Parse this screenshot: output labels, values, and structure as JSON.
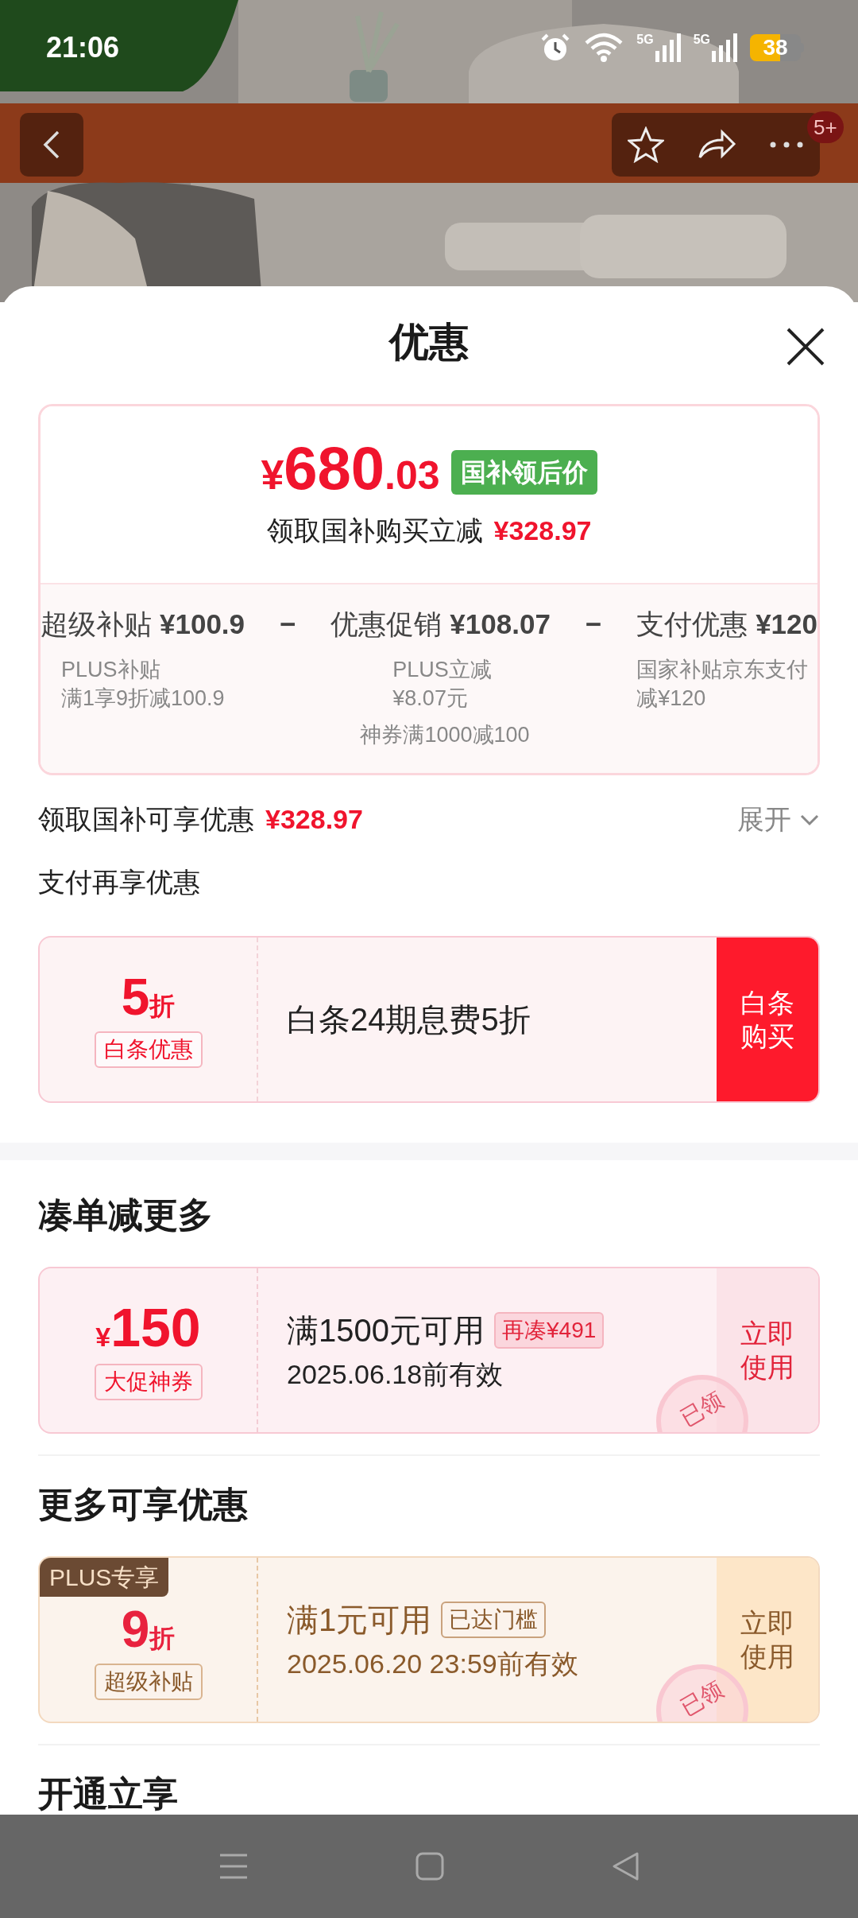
{
  "status_bar": {
    "time": "21:06",
    "network_1": "5G",
    "network_2": "5G",
    "battery": "38"
  },
  "header": {
    "badge": "5+"
  },
  "sheet": {
    "title": "优惠"
  },
  "price_card": {
    "currency": "¥",
    "integer": "680",
    "decimal": ".03",
    "tag": "国补领后价",
    "saving_label": "领取国补购买立减",
    "saving_amount": "¥328.97",
    "breakdown": [
      {
        "label": "超级补贴",
        "amount": "¥100.9",
        "details": [
          "PLUS补贴",
          "满1享9折减100.9"
        ]
      },
      {
        "label": "优惠促销",
        "amount": "¥108.07",
        "details": [
          "PLUS立减",
          "¥8.07元"
        ]
      },
      {
        "label": "支付优惠",
        "amount": "¥120",
        "details": [
          "国家补贴京东支付",
          "减¥120"
        ]
      }
    ],
    "separators": [
      "−",
      "−"
    ],
    "note": "神券满1000减100"
  },
  "subsidy_summary": {
    "label": "领取国补可享优惠",
    "amount": "¥328.97",
    "toggle": "展开",
    "expanded": false
  },
  "payment": {
    "heading": "支付再享优惠",
    "offer": {
      "value": "5",
      "suffix": "折",
      "tag": "白条优惠",
      "description": "白条24期息费5折",
      "button": "白条购买"
    }
  },
  "sections": [
    {
      "title": "凑单减更多",
      "coupons": [
        {
          "kind": "cash",
          "prefix": "¥",
          "value": "150",
          "tag": "大促神券",
          "condition": "满1500元可用",
          "badge": "再凑¥491",
          "validity": "2025.06.18前有效",
          "button": "立即使用",
          "stamp": "已领"
        }
      ]
    },
    {
      "title": "更多可享优惠",
      "coupons": [
        {
          "kind": "discount",
          "ribbon": "PLUS专享",
          "value": "9",
          "suffix": "折",
          "tag": "超级补贴",
          "condition": "满1元可用",
          "badge": "已达门槛",
          "validity": "2025.06.20 23:59前有效",
          "button": "立即使用",
          "stamp": "已领"
        }
      ]
    },
    {
      "title": "开通立享"
    }
  ]
}
